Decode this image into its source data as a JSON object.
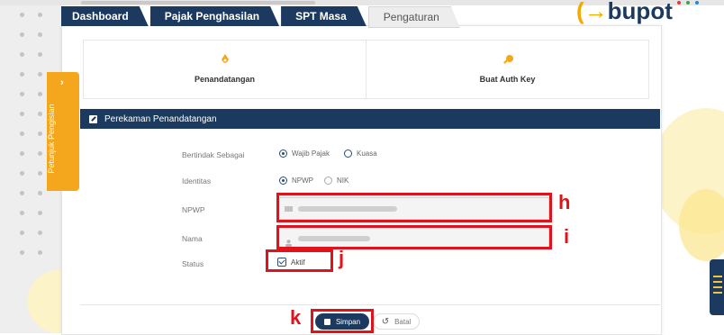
{
  "brand": {
    "text": "bupot"
  },
  "nav": {
    "tabs": [
      {
        "label": "Dashboard"
      },
      {
        "label": "Pajak Penghasilan"
      },
      {
        "label": "SPT Masa"
      },
      {
        "label": "Pengaturan"
      }
    ]
  },
  "settings_cards": [
    {
      "label": "Penandatangan",
      "icon": "pen-nib-icon"
    },
    {
      "label": "Buat Auth Key",
      "icon": "key-icon"
    }
  ],
  "side_tab": {
    "label": "Petunjuk Pengisian",
    "arrow": "›"
  },
  "section": {
    "title": "Perekaman Penandatangan"
  },
  "form": {
    "bertindak": {
      "label": "Bertindak Sebagai",
      "options": [
        "Wajib Pajak",
        "Kuasa"
      ],
      "selected": "Wajib Pajak"
    },
    "identitas": {
      "label": "Identitas",
      "options": [
        "NPWP",
        "NIK"
      ],
      "selected": "NPWP"
    },
    "npwp": {
      "label": "NPWP"
    },
    "nama": {
      "label": "Nama"
    },
    "status": {
      "label": "Status",
      "checkbox_label": "Aktif",
      "checked": true
    }
  },
  "buttons": {
    "save": "Simpan",
    "cancel": "Batal"
  },
  "annotations": {
    "h": "h",
    "i": "i",
    "j": "j",
    "k": "k"
  },
  "colors": {
    "navy": "#1c3a5f",
    "accent": "#f4a71d",
    "annotation_red": "#e0131c"
  }
}
